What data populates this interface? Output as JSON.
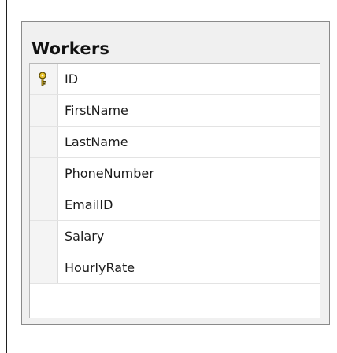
{
  "table": {
    "title": "Workers",
    "columns": [
      {
        "name": "ID",
        "primary_key": true,
        "icon": "key-icon"
      },
      {
        "name": "FirstName",
        "primary_key": false
      },
      {
        "name": "LastName",
        "primary_key": false
      },
      {
        "name": "PhoneNumber",
        "primary_key": false
      },
      {
        "name": "EmailID",
        "primary_key": false
      },
      {
        "name": "Salary",
        "primary_key": false
      },
      {
        "name": "HourlyRate",
        "primary_key": false
      }
    ]
  },
  "colors": {
    "panel_background": "#f0f0f0",
    "panel_border": "#8a8a8a",
    "grid_background": "#ffffff",
    "key_icon": "#d9b21a"
  }
}
